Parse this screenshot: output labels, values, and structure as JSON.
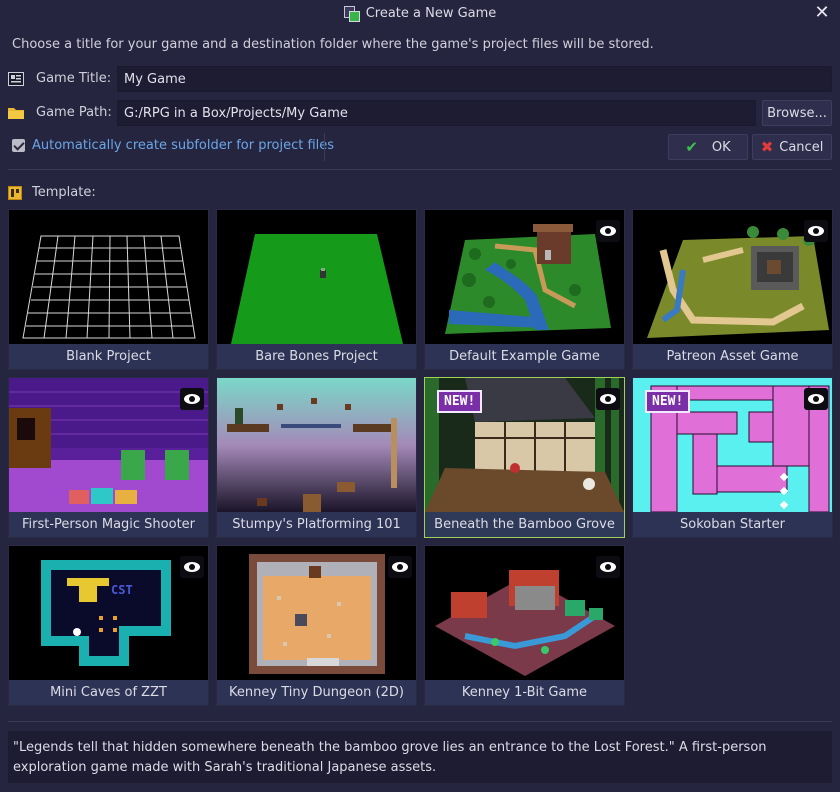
{
  "window": {
    "title": "Create a New Game",
    "app_icon": "project-icon",
    "close_icon": "close-icon"
  },
  "intro_text": "Choose a title for your game and a destination folder where the game's project files will be stored.",
  "title_row": {
    "label": "Game Title:",
    "icon": "text-field-icon",
    "value": "My Game"
  },
  "path_row": {
    "label": "Game Path:",
    "icon": "folder-icon",
    "value": "G:/RPG in a Box/Projects/My Game",
    "browse_label": "Browse..."
  },
  "subfolder": {
    "label": "Automatically create subfolder for project files",
    "checked": true
  },
  "ok_label": "OK",
  "cancel_label": "Cancel",
  "template_label": "Template:",
  "templates": [
    {
      "name": "Blank Project",
      "preview": false,
      "is_new": false,
      "selected": false
    },
    {
      "name": "Bare Bones Project",
      "preview": false,
      "is_new": false,
      "selected": false
    },
    {
      "name": "Default Example Game",
      "preview": true,
      "is_new": false,
      "selected": false
    },
    {
      "name": "Patreon Asset Game",
      "preview": true,
      "is_new": false,
      "selected": false
    },
    {
      "name": "First-Person Magic Shooter",
      "preview": true,
      "is_new": false,
      "selected": false
    },
    {
      "name": "Stumpy's Platforming 101",
      "preview": false,
      "is_new": false,
      "selected": false
    },
    {
      "name": "Beneath the Bamboo Grove",
      "preview": true,
      "is_new": true,
      "selected": true
    },
    {
      "name": "Sokoban Starter",
      "preview": true,
      "is_new": true,
      "selected": false
    },
    {
      "name": "Mini Caves of ZZT",
      "preview": true,
      "is_new": false,
      "selected": false
    },
    {
      "name": "Kenney Tiny Dungeon (2D)",
      "preview": true,
      "is_new": false,
      "selected": false
    },
    {
      "name": "Kenney 1-Bit Game",
      "preview": true,
      "is_new": false,
      "selected": false
    }
  ],
  "new_badge_text": "NEW!",
  "description": "\"Legends tell that hidden somewhere beneath the bamboo grove lies an entrance to the Lost Forest.\" A first-person exploration game made with Sarah's traditional Japanese assets.",
  "colors": {
    "accent_link": "#6aa6e8",
    "selected_border": "#9ed25a",
    "new_badge": "#7a2fa8"
  }
}
